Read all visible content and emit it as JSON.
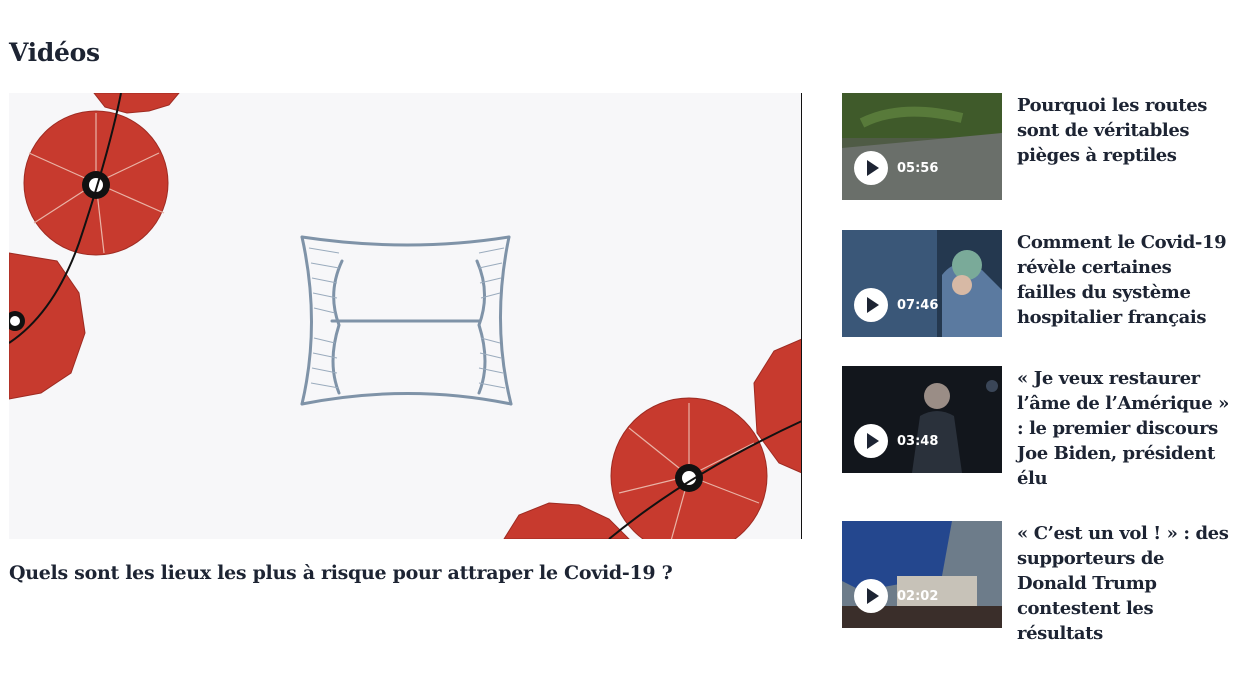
{
  "section": {
    "title": "Vidéos"
  },
  "main": {
    "caption": "Quels sont les lieux les plus à risque pour attraper le Covid-19 ?"
  },
  "side": {
    "items": [
      {
        "title": "Pourquoi les routes sont de véritables pièges à reptiles",
        "duration": "05:56"
      },
      {
        "title": "Comment le Covid-19 révèle certaines failles du système hospitalier français",
        "duration": "07:46"
      },
      {
        "title": "« Je veux restaurer l’âme de l’Amérique » : le premier discours Joe Biden, président élu",
        "duration": "03:48"
      },
      {
        "title": "« C’est un vol ! » : des supporteurs de Donald Trump contestent les résultats",
        "duration": "02:02"
      }
    ]
  },
  "colors": {
    "accent_red": "#c73a2e",
    "text_dark": "#1d2433",
    "sketch_blue": "#7f93a8"
  }
}
